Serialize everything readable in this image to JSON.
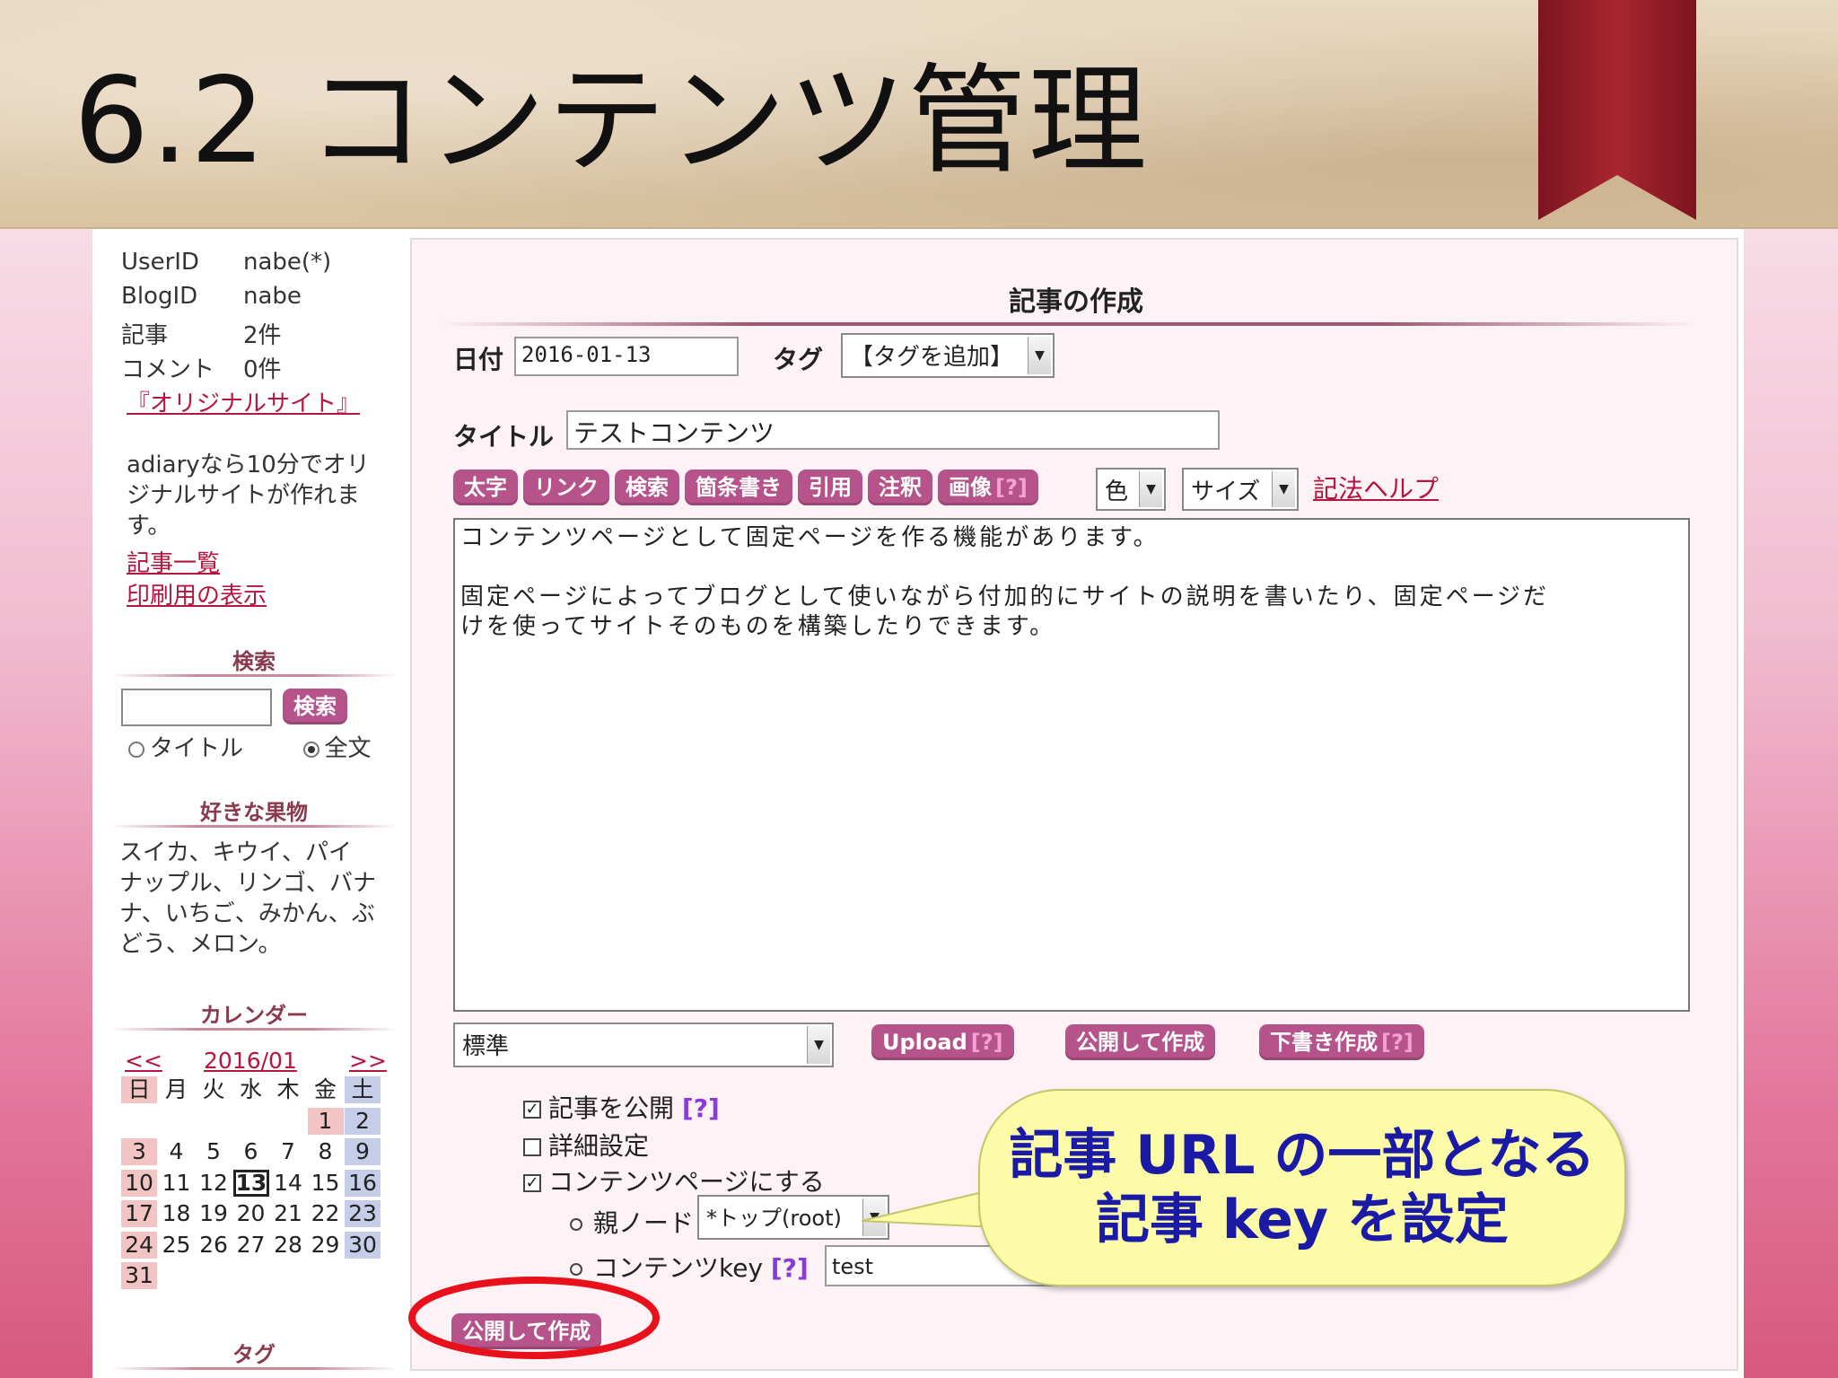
{
  "slide": {
    "title": "6.2 コンテンツ管理"
  },
  "sidebar": {
    "info": [
      {
        "key": "UserID",
        "value": "nabe(*)"
      },
      {
        "key": "BlogID",
        "value": "nabe"
      },
      {
        "key": "記事",
        "value": "2件"
      },
      {
        "key": "コメント",
        "value": "0件"
      }
    ],
    "original_site_link": "『オリジナルサイト』",
    "description": [
      "adiaryなら10分でオリ",
      "ジナルサイトが作れま",
      "す。"
    ],
    "links": {
      "articles": "記事一覧",
      "print": "印刷用の表示"
    },
    "search": {
      "heading": "検索",
      "button": "検索",
      "radio_title": "タイトル",
      "radio_full": "全文"
    },
    "fruits": {
      "heading": "好きな果物",
      "lines": [
        "スイカ、キウイ、パイ",
        "ナップル、リンゴ、バナ",
        "ナ、いちご、みかん、ぶ",
        "どう、メロン。"
      ]
    },
    "calendar": {
      "heading": "カレンダー",
      "prev": "<<",
      "month": "2016/01",
      "next": ">>",
      "weekdays": [
        "日",
        "月",
        "火",
        "水",
        "木",
        "金",
        "土"
      ],
      "today": 13
    },
    "tag_heading": "タグ"
  },
  "editor": {
    "title": "記事の作成",
    "date_label": "日付",
    "date_value": "2016-01-13",
    "tag_label": "タグ",
    "tag_select": "【タグを追加】",
    "title_label": "タイトル",
    "title_value": "テストコンテンツ",
    "toolbar": [
      "太字",
      "リンク",
      "検索",
      "箇条書き",
      "引用",
      "注釈",
      "画像"
    ],
    "toolbar_q": "[?]",
    "color_select": "色",
    "size_select": "サイズ",
    "help_link": "記法ヘルプ",
    "body_lines": [
      "コンテンツページとして固定ページを作る機能があります。",
      "",
      "固定ページによってブログとして使いながら付加的にサイトの説明を書いたり、固定ページだ",
      "けを使ってサイトそのものを構築したりできます。"
    ],
    "parser_select": "標準",
    "upload_button": "Upload",
    "publish_button": "公開して作成",
    "draft_button": "下書き作成",
    "q": "[?]",
    "publish_checkbox": "記事を公開",
    "detail_checkbox": "詳細設定",
    "content_checkbox": "コンテンツページにする",
    "parent_label": "親ノード",
    "parent_select": "*トップ(root)",
    "contents_key_label": "コンテンツkey",
    "contents_key_value": "test",
    "bottom_publish_button": "公開して作成"
  },
  "callout": {
    "line1": "記事 URL の一部となる",
    "line2": "記事 key を設定"
  },
  "colors": {
    "accent": "#b5538a",
    "link": "#b5163f",
    "callout_bg": "#fbfba8",
    "callout_text": "#1a1aa6",
    "highlight": "#e8101a"
  }
}
